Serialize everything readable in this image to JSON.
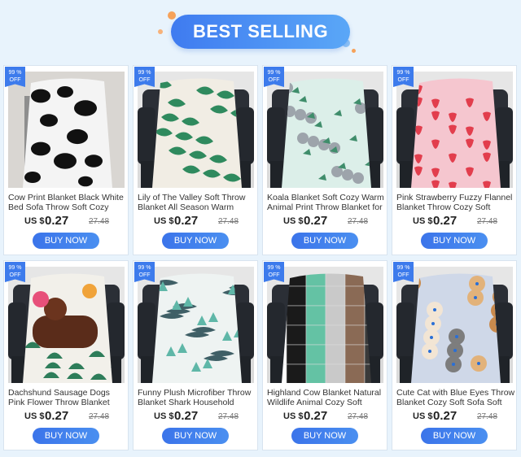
{
  "header": {
    "title": "BEST SELLING"
  },
  "badge": {
    "line1": "99 %",
    "line2": "OFF"
  },
  "button_label": "BUY NOW",
  "products": [
    {
      "title": "Cow Print Blanket Black White Bed Sofa Throw Soft Cozy Sofa",
      "currency": "US $",
      "price": "0.27",
      "old_price": "27.48",
      "pattern": "cow"
    },
    {
      "title": "Lily of The Valley Soft Throw Blanket All Season Warm Plush",
      "currency": "US $",
      "price": "0.27",
      "old_price": "27.48",
      "pattern": "leaves"
    },
    {
      "title": "Koala Blanket Soft Cozy Warm Animal Print Throw Blanket for",
      "currency": "US $",
      "price": "0.27",
      "old_price": "27.48",
      "pattern": "koala"
    },
    {
      "title": "Pink Strawberry Fuzzy Flannel Blanket Throw Cozy Soft",
      "currency": "US $",
      "price": "0.27",
      "old_price": "27.48",
      "pattern": "strawberry"
    },
    {
      "title": "Dachshund Sausage Dogs Pink Flower Throw Blanket Cozy Soft",
      "currency": "US $",
      "price": "0.27",
      "old_price": "27.48",
      "pattern": "dachshund"
    },
    {
      "title": "Funny Plush Microfiber Throw Blanket Shark Household Warm",
      "currency": "US $",
      "price": "0.27",
      "old_price": "27.48",
      "pattern": "shark"
    },
    {
      "title": "Highland Cow Blanket Natural Wildlife Animal Cozy Soft",
      "currency": "US $",
      "price": "0.27",
      "old_price": "27.48",
      "pattern": "patchwork"
    },
    {
      "title": "Cute Cat with Blue Eyes Throw Blanket Cozy Soft Sofa Soft Cute",
      "currency": "US $",
      "price": "0.27",
      "old_price": "27.48",
      "pattern": "cats"
    }
  ]
}
